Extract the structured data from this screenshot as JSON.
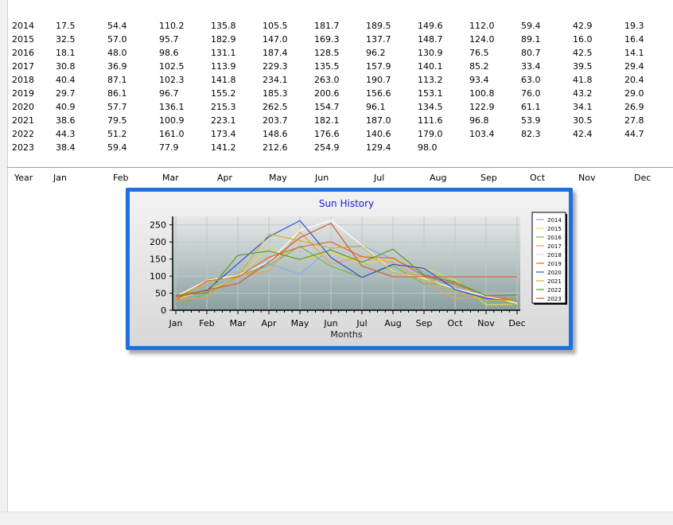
{
  "table": {
    "rows": [
      {
        "year": "2014",
        "values": [
          "17.5",
          "54.4",
          "110.2",
          "135.8",
          "105.5",
          "181.7",
          "189.5",
          "149.6",
          "112.0",
          "59.4",
          "42.9",
          "19.3"
        ]
      },
      {
        "year": "2015",
        "values": [
          "32.5",
          "57.0",
          "95.7",
          "182.9",
          "147.0",
          "169.3",
          "137.7",
          "148.7",
          "124.0",
          "89.1",
          "16.0",
          "16.4"
        ]
      },
      {
        "year": "2016",
        "values": [
          "18.1",
          "48.0",
          "98.6",
          "131.1",
          "187.4",
          "128.5",
          "96.2",
          "130.9",
          "76.5",
          "80.7",
          "42.5",
          "14.1"
        ]
      },
      {
        "year": "2017",
        "values": [
          "30.8",
          "36.9",
          "102.5",
          "113.9",
          "229.3",
          "135.5",
          "157.9",
          "140.1",
          "85.2",
          "33.4",
          "39.5",
          "29.4"
        ]
      },
      {
        "year": "2018",
        "values": [
          "40.4",
          "87.1",
          "102.3",
          "141.8",
          "234.1",
          "263.0",
          "190.7",
          "113.2",
          "93.4",
          "63.0",
          "41.8",
          "20.4"
        ]
      },
      {
        "year": "2019",
        "values": [
          "29.7",
          "86.1",
          "96.7",
          "155.2",
          "185.3",
          "200.6",
          "156.6",
          "153.1",
          "100.8",
          "76.0",
          "43.2",
          "29.0"
        ]
      },
      {
        "year": "2020",
        "values": [
          "40.9",
          "57.7",
          "136.1",
          "215.3",
          "262.5",
          "154.7",
          "96.1",
          "134.5",
          "122.9",
          "61.1",
          "34.1",
          "26.9"
        ]
      },
      {
        "year": "2021",
        "values": [
          "38.6",
          "79.5",
          "100.9",
          "223.1",
          "203.7",
          "182.1",
          "187.0",
          "111.6",
          "96.8",
          "53.9",
          "30.5",
          "27.8"
        ]
      },
      {
        "year": "2022",
        "values": [
          "44.3",
          "51.2",
          "161.0",
          "173.4",
          "148.6",
          "176.6",
          "140.6",
          "179.0",
          "103.4",
          "82.3",
          "42.4",
          "44.7"
        ]
      },
      {
        "year": "2023",
        "values": [
          "38.4",
          "59.4",
          "77.9",
          "141.2",
          "212.6",
          "254.9",
          "129.4",
          "98.0",
          "",
          "",
          "",
          ""
        ]
      }
    ],
    "header": {
      "year": "Year",
      "months": [
        "Jan",
        "Feb",
        "Mar",
        "Apr",
        "May",
        "Jun",
        "Jul",
        "Aug",
        "Sep",
        "Oct",
        "Nov",
        "Dec"
      ]
    }
  },
  "chart_data": {
    "type": "line",
    "title": "Sun History",
    "xlabel": "Months",
    "ylabel": "",
    "categories": [
      "Jan",
      "Feb",
      "Mar",
      "Apr",
      "May",
      "Jun",
      "Jul",
      "Aug",
      "Sep",
      "Oct",
      "Nov",
      "Dec"
    ],
    "ylim": [
      0,
      275
    ],
    "yticks": [
      "0",
      "50",
      "100",
      "150",
      "200",
      "250"
    ],
    "legend_position": "right",
    "grid": true,
    "series": [
      {
        "name": "2014",
        "color": "#8fa8e8",
        "values": [
          17.5,
          54.4,
          110.2,
          135.8,
          105.5,
          181.7,
          189.5,
          149.6,
          112.0,
          59.4,
          42.9,
          19.3
        ]
      },
      {
        "name": "2015",
        "color": "#e8d84a",
        "values": [
          32.5,
          57.0,
          95.7,
          182.9,
          147.0,
          169.3,
          137.7,
          148.7,
          124.0,
          89.1,
          16.0,
          16.4
        ]
      },
      {
        "name": "2016",
        "color": "#7ab84a",
        "values": [
          18.1,
          48.0,
          98.6,
          131.1,
          187.4,
          128.5,
          96.2,
          130.9,
          76.5,
          80.7,
          42.5,
          14.1
        ]
      },
      {
        "name": "2017",
        "color": "#f0a040",
        "values": [
          30.8,
          36.9,
          102.5,
          113.9,
          229.3,
          135.5,
          157.9,
          140.1,
          85.2,
          33.4,
          39.5,
          29.4
        ]
      },
      {
        "name": "2018",
        "color": "#ffffff",
        "values": [
          40.4,
          87.1,
          102.3,
          141.8,
          234.1,
          263.0,
          190.7,
          113.2,
          93.4,
          63.0,
          41.8,
          20.4
        ]
      },
      {
        "name": "2019",
        "color": "#e86030",
        "values": [
          29.7,
          86.1,
          96.7,
          155.2,
          185.3,
          200.6,
          156.6,
          153.1,
          100.8,
          76.0,
          43.2,
          29.0
        ]
      },
      {
        "name": "2020",
        "color": "#3050d8",
        "values": [
          40.9,
          57.7,
          136.1,
          215.3,
          262.5,
          154.7,
          96.1,
          134.5,
          122.9,
          61.1,
          34.1,
          26.9
        ]
      },
      {
        "name": "2021",
        "color": "#d0b820",
        "values": [
          38.6,
          79.5,
          100.9,
          223.1,
          203.7,
          182.1,
          187.0,
          111.6,
          96.8,
          53.9,
          30.5,
          27.8
        ]
      },
      {
        "name": "2022",
        "color": "#5a9a30",
        "values": [
          44.3,
          51.2,
          161.0,
          173.4,
          148.6,
          176.6,
          140.6,
          179.0,
          103.4,
          82.3,
          42.4,
          44.7
        ]
      },
      {
        "name": "2023",
        "color": "#d85a30",
        "values": [
          38.4,
          59.4,
          77.9,
          141.2,
          212.6,
          254.9,
          129.4,
          98.0,
          98.0,
          98.0,
          98.0,
          98.0
        ]
      }
    ]
  }
}
